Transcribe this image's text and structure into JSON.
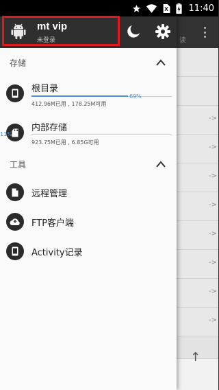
{
  "status_bar": {
    "time": "11:40",
    "icons": [
      "star-icon",
      "wifi-icon",
      "no-sim-icon",
      "battery-charging-icon"
    ]
  },
  "drawer": {
    "header": {
      "title": "mt vip",
      "subtitle": "未登录",
      "icons": [
        "android-icon",
        "night-mode-icon",
        "settings-gear-icon"
      ]
    },
    "storage_section": {
      "title": "存储",
      "items": [
        {
          "label": "根目录",
          "detail": "412.96M已用 , 178.25M可用",
          "percent_label": "69%",
          "percent": 69,
          "icon": "phone-icon"
        },
        {
          "label": "内部存储",
          "detail": "923.75M已用 , 6.85G可用",
          "percent_label": "11%",
          "percent": 11,
          "icon": "sd-card-icon"
        }
      ]
    },
    "tools_section": {
      "title": "工具",
      "items": [
        {
          "label": "远程管理",
          "icon": "document-icon"
        },
        {
          "label": "FTP客户端",
          "icon": "cloud-transfer-icon"
        },
        {
          "label": "Activity记录",
          "icon": "phone-icon"
        }
      ]
    }
  },
  "background_app": {
    "tab_text": "读",
    "row_arrow": "->",
    "up_icon": "↑"
  },
  "colors": {
    "accent": "#4a8fe0",
    "highlight_box": "#e0191c",
    "header_bg": "#2f2f2f"
  }
}
